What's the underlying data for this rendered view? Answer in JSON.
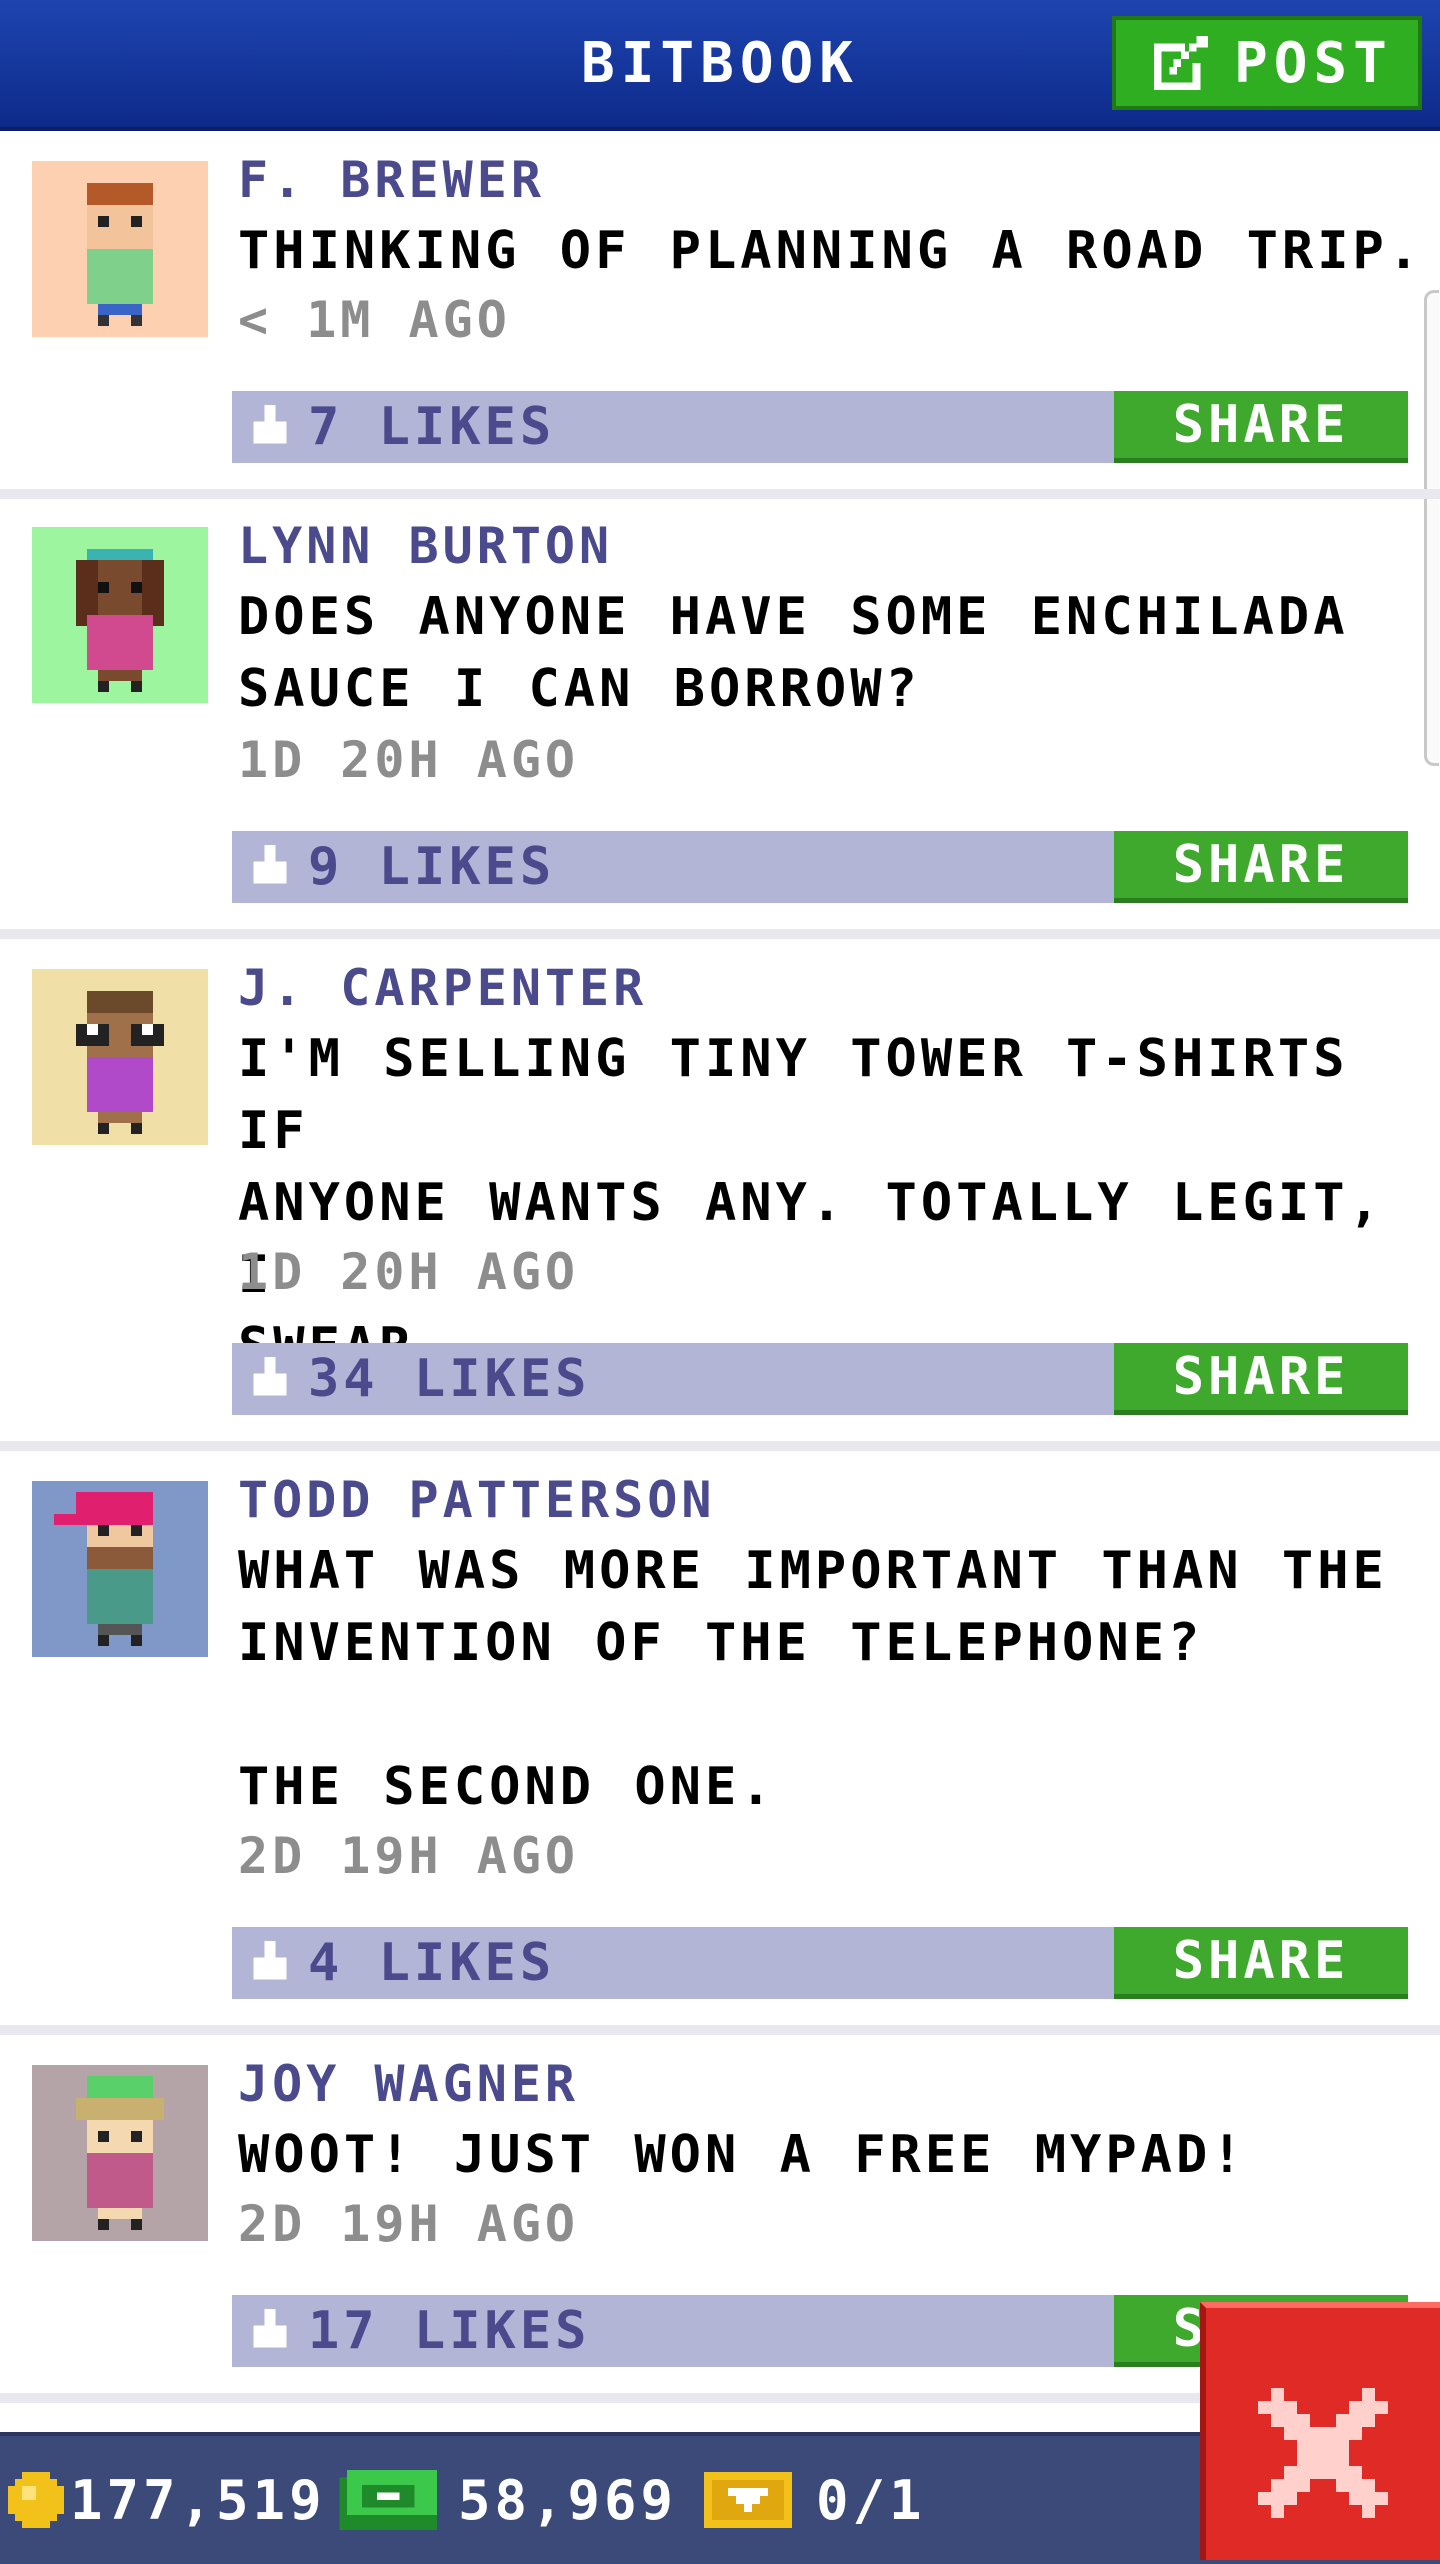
{
  "header": {
    "title": "BITBOOK",
    "post_label": "POST"
  },
  "posts": [
    {
      "author": "F. BREWER",
      "message": "THINKING OF PLANNING A ROAD TRIP.",
      "time": "< 1M AGO",
      "likes": "7 LIKES",
      "share": "SHARE",
      "avatar_bg": "#fcd0b0"
    },
    {
      "author": "LYNN BURTON",
      "message": "DOES ANYONE HAVE SOME ENCHILADA\nSAUCE I CAN BORROW?",
      "time": "1D 20H AGO",
      "likes": "9 LIKES",
      "share": "SHARE",
      "avatar_bg": "#9ef5a0"
    },
    {
      "author": "J. CARPENTER",
      "message": "I'M SELLING TINY TOWER T-SHIRTS IF\nANYONE WANTS ANY. TOTALLY LEGIT, I\nSWEAR.",
      "time": "1D 20H AGO",
      "likes": "34 LIKES",
      "share": "SHARE",
      "avatar_bg": "#f0e0a8"
    },
    {
      "author": "TODD PATTERSON",
      "message": "WHAT WAS MORE IMPORTANT THAN THE\nINVENTION OF THE TELEPHONE?\n\nTHE SECOND ONE.",
      "time": "2D 19H AGO",
      "likes": "4 LIKES",
      "share": "SHARE",
      "avatar_bg": "#7f98c8"
    },
    {
      "author": "JOY WAGNER",
      "message": "WOOT! JUST WON A FREE MYPAD!",
      "time": "2D 19H AGO",
      "likes": "17 LIKES",
      "share": "SHARE",
      "avatar_bg": "#b4a4a8"
    }
  ],
  "bottom_bar": {
    "coins": "177,519",
    "bux": "58,969",
    "tickets": "0/1"
  },
  "colors": {
    "header": "#1e44b0",
    "accent_green": "#3ea92c",
    "likes_bar": "#b3b5d6",
    "author_text": "#4a4a8c",
    "close_red": "#e02a25"
  },
  "icons": {
    "post": "edit-icon",
    "like": "thumbs-up-icon",
    "coin": "coin-icon",
    "bux": "bux-icon",
    "ticket": "ticket-icon",
    "close": "close-icon"
  }
}
